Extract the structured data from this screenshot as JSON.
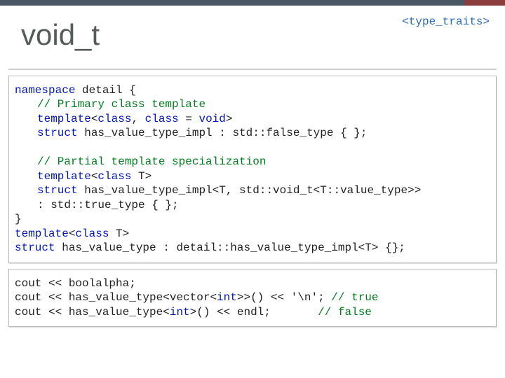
{
  "header_tag": "<type_traits>",
  "title": "void_t",
  "code1": {
    "l1a": "namespace",
    "l1b": " detail {",
    "l2": "// Primary class template",
    "l3a": "template",
    "l3b": "<",
    "l3c": "class",
    "l3d": ", ",
    "l3e": "class",
    "l3f": " = ",
    "l3g": "void",
    "l3h": ">",
    "l4a": "struct",
    "l4b": " has_value_type_impl : std::false_type { };",
    "blank": " ",
    "l5": "// Partial template specialization",
    "l6a": "template",
    "l6b": "<",
    "l6c": "class",
    "l6d": " T>",
    "l7a": "struct",
    "l7b": " has_value_type_impl<T, std::void_t<T::value_type>>",
    "l8": ": std::true_type { };",
    "l9": "}",
    "l10a": "template",
    "l10b": "<",
    "l10c": "class",
    "l10d": " T>",
    "l11a": "struct",
    "l11b": " has_value_type : detail::has_value_type_impl<T> {};"
  },
  "code2": {
    "l1a": "cout << boolalpha;",
    "l2a": "cout << has_value_type<vector<",
    "l2b": "int",
    "l2c": ">>() << ",
    "l2d": "'\\n'",
    "l2e": "; ",
    "l2f": "// true",
    "l3a": "cout << has_value_type<",
    "l3b": "int",
    "l3c": ">() << endl;       ",
    "l3f": "// false"
  }
}
